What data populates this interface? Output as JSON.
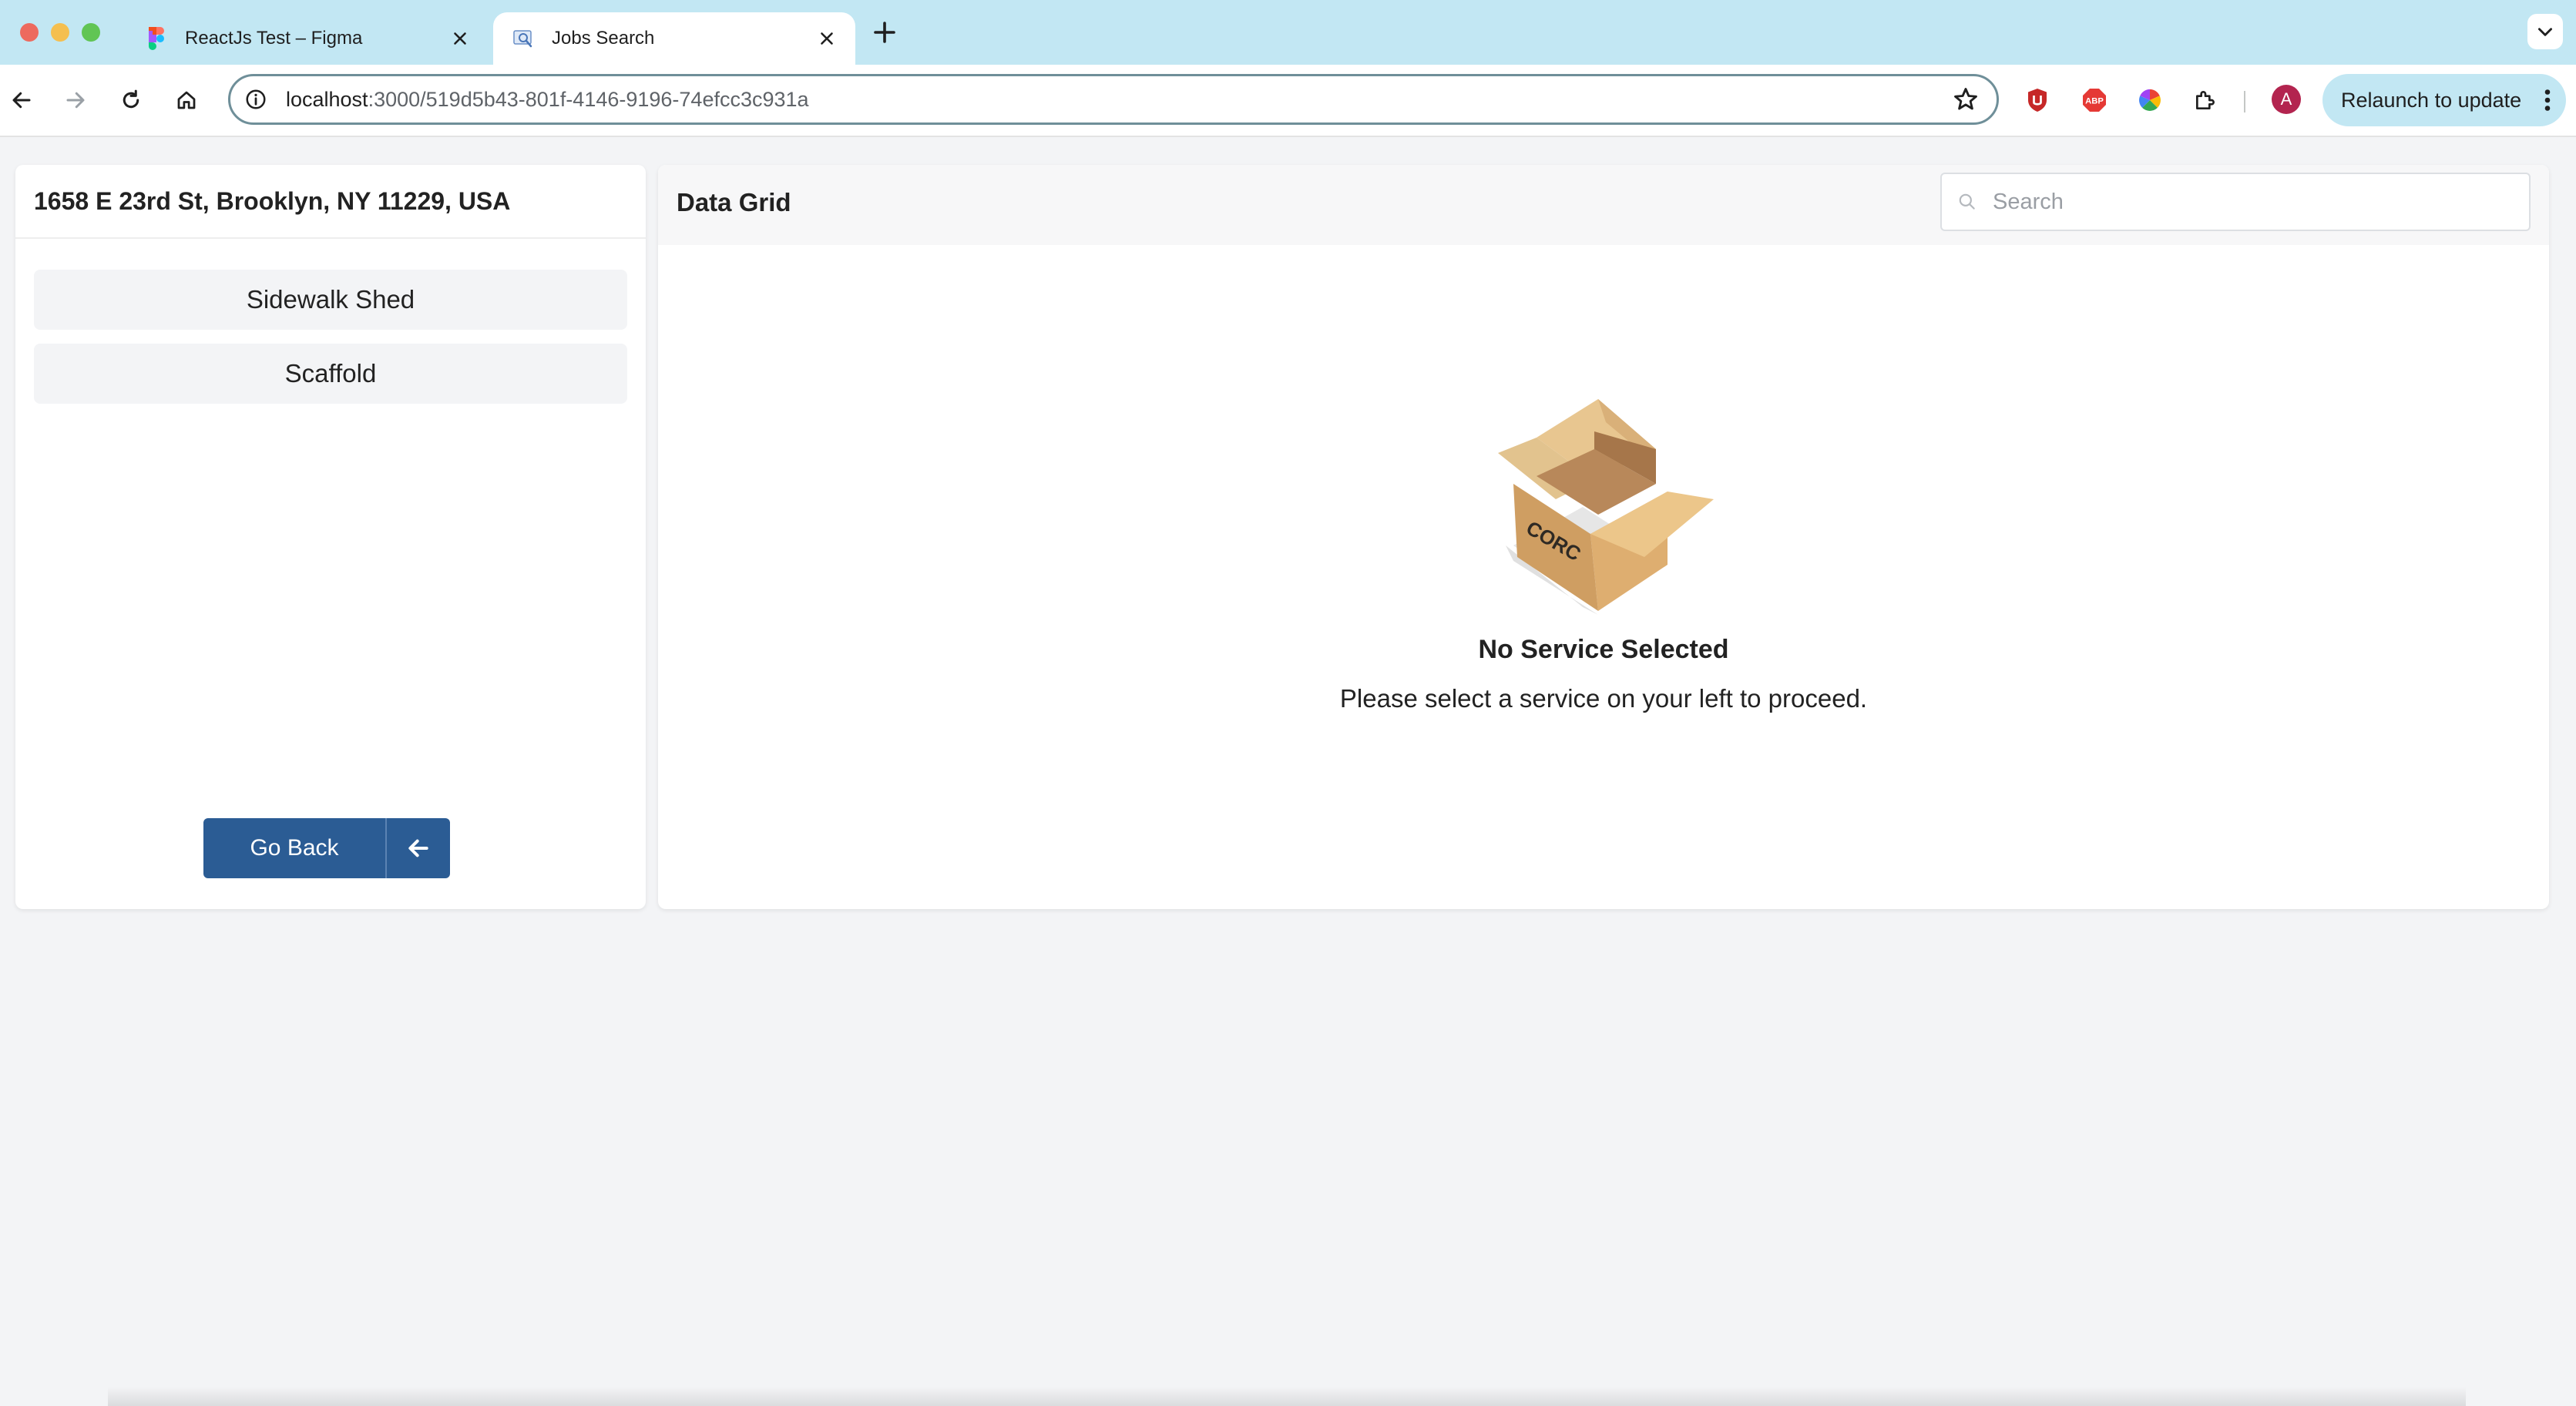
{
  "browser": {
    "tabs": [
      {
        "title": "ReactJs Test – Figma",
        "active": false
      },
      {
        "title": "Jobs Search",
        "active": true
      }
    ],
    "url_host": "localhost",
    "url_path": ":3000/519d5b43-801f-4146-9196-74efcc3c931a",
    "profile_initial": "A",
    "relaunch_label": "Relaunch to update",
    "extensions": [
      "ublock-icon",
      "adblock-plus-icon",
      "color-picker-icon",
      "puzzle-icon"
    ]
  },
  "sidebar": {
    "address": "1658 E 23rd St, Brooklyn, NY 11229, USA",
    "services": [
      {
        "label": "Sidewalk Shed"
      },
      {
        "label": "Scaffold"
      }
    ],
    "go_back_label": "Go Back"
  },
  "grid": {
    "title": "Data Grid",
    "search_placeholder": "Search",
    "search_value": "",
    "empty_title": "No Service Selected",
    "empty_message": "Please select a service on your left to proceed.",
    "box_label": "CORC"
  },
  "colors": {
    "tab_strip": "#c2e7f3",
    "primary_button": "#2b5c94",
    "page_background": "#f3f4f6",
    "avatar": "#b3244f"
  }
}
